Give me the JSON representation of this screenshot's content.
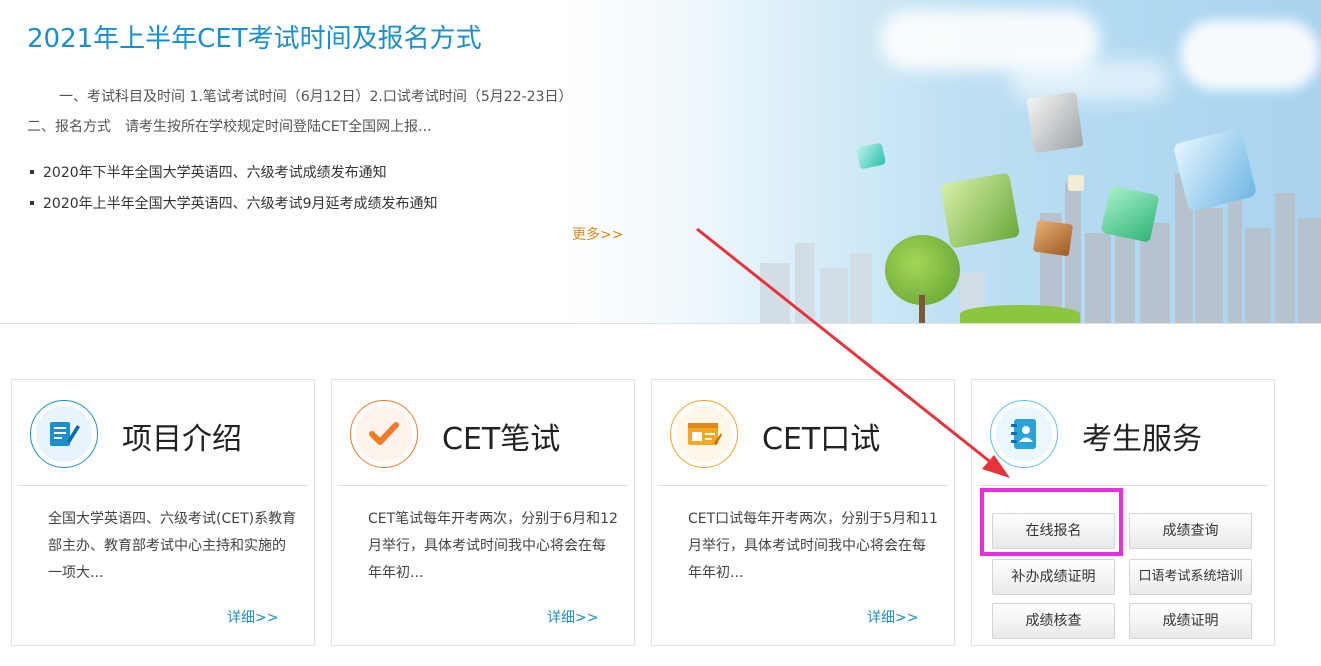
{
  "news": {
    "title": "2021年上半年CET考试时间及报名方式",
    "summary": "一、考试科目及时间 1.笔试考试时间（6月12日）2.口试考试时间（5月22-23日） 二、报名方式　请考生按所在学校规定时间登陆CET全国网上报...",
    "items": [
      "2020年下半年全国大学英语四、六级考试成绩发布通知",
      "2020年上半年全国大学英语四、六级考试9月延考成绩发布通知"
    ],
    "more_label": "更多>>"
  },
  "cards": [
    {
      "title": "项目介绍",
      "icon": "document-edit-icon",
      "desc": "全国大学英语四、六级考试(CET)系教育部主办、教育部考试中心主持和实施的一项大...",
      "more_label": "详细>>"
    },
    {
      "title": "CET笔试",
      "icon": "checkmark-icon",
      "desc": "CET笔试每年开考两次，分别于6月和12月举行，具体考试时间我中心将会在每年年初...",
      "more_label": "详细>>"
    },
    {
      "title": "CET口试",
      "icon": "id-card-icon",
      "desc": "CET口试每年开考两次，分别于5月和11月举行，具体考试时间我中心将会在每年年初...",
      "more_label": "详细>>"
    },
    {
      "title": "考生服务",
      "icon": "address-book-icon",
      "buttons": [
        "在线报名",
        "成绩查询",
        "补办成绩证明",
        "口语考试系统培训",
        "成绩核查",
        "成绩证明"
      ]
    }
  ],
  "colors": {
    "title_blue": "#1a8fcf",
    "more_orange": "#e08a1e",
    "highlight_magenta": "#e52fe0",
    "arrow_red": "#e8333a",
    "icon_blue": "#1a8fcf",
    "icon_orange": "#f07a2a",
    "icon_amber": "#f5a623"
  }
}
